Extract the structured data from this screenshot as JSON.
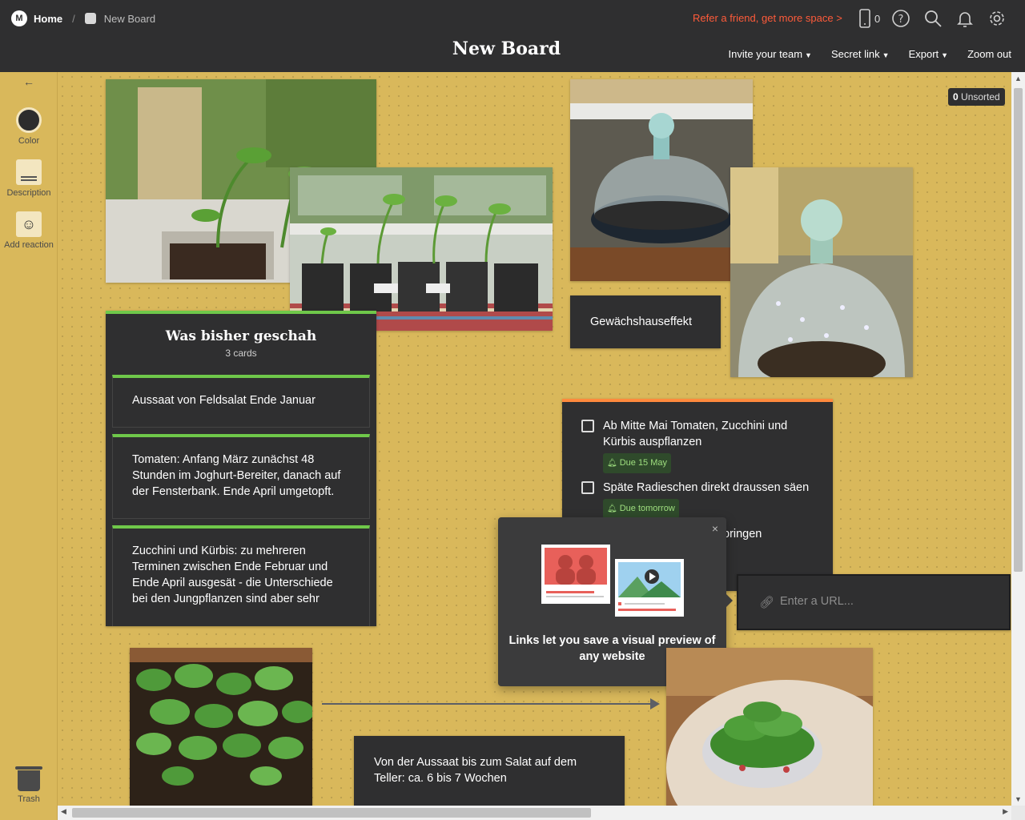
{
  "breadcrumb": {
    "home_label": "Home",
    "board_label": "New Board"
  },
  "topbar": {
    "refer_label": "Refer a friend, get more space >",
    "device_count": "0",
    "menu": {
      "invite": "Invite your team",
      "secret": "Secret link",
      "export": "Export",
      "zoom": "Zoom out"
    }
  },
  "board": {
    "title": "New Board"
  },
  "toolbar": {
    "color": "Color",
    "description": "Description",
    "reaction": "Add reaction",
    "trash": "Trash"
  },
  "unsorted": {
    "count": "0",
    "label": "Unsorted"
  },
  "column": {
    "title": "Was bisher geschah",
    "count_label": "3 cards",
    "cards": [
      "Aussaat von Feldsalat Ende Januar",
      "Tomaten: Anfang März zunächst 48 Stunden im Joghurt-Bereiter, danach auf der Fensterbank. Ende April umgetopft.",
      "Zucchini und Kürbis: zu mehreren Terminen zwischen Ende Februar und Ende April ausgesät - die Unterschiede bei den Jungpflanzen sind aber sehr"
    ]
  },
  "note_greenhouse": "Gewächshauseffekt",
  "todo": {
    "items": [
      {
        "text": "Ab Mitte Mai Tomaten, Zucchini und Kürbis auspflanzen",
        "due": "Due 15 May"
      },
      {
        "text": "Späte Radieschen direkt draussen säen",
        "due": "Due tomorrow"
      },
      {
        "text": "bringen"
      }
    ]
  },
  "url_box": {
    "placeholder": "Enter a URL..."
  },
  "popover": {
    "close": "×",
    "text": "Links let you save a visual preview of any website"
  },
  "note_salad": "Von der Aussaat bis zum Salat auf dem Teller: ca. 6 bis 7 Wochen",
  "colors": {
    "canvas": "#d9b85b",
    "dark": "#2f2f30",
    "accent_green": "#6fc84a",
    "accent_orange": "#ff8a3d",
    "refer_red": "#ff5b3a"
  }
}
